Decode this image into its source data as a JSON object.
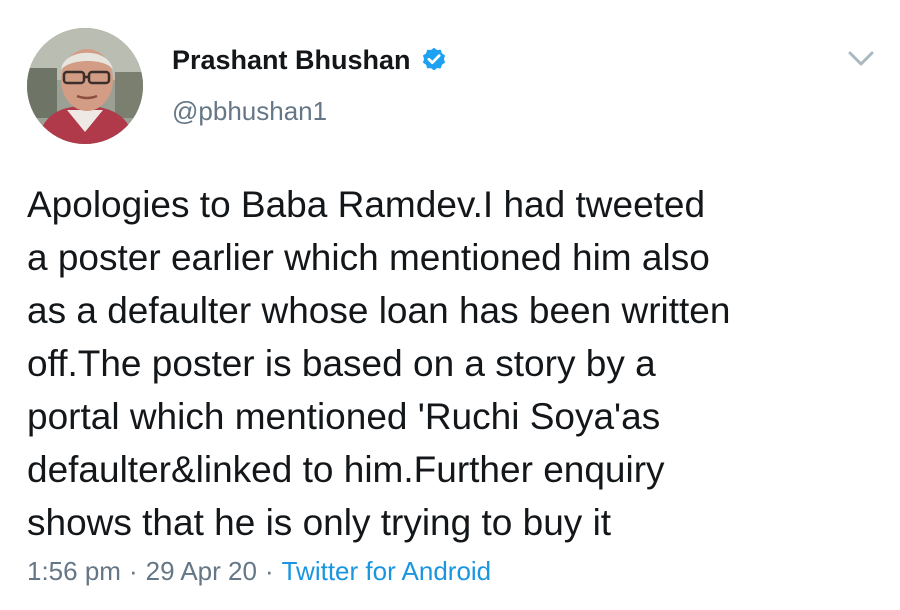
{
  "author": {
    "display_name": "Prashant Bhushan",
    "handle": "@pbhushan1",
    "verified_icon": "verified-badge-icon"
  },
  "menu": {
    "icon": "chevron-down-icon"
  },
  "tweet": {
    "text": "Apologies to Baba Ramdev.I had tweeted\na poster earlier which mentioned him also\nas a defaulter whose loan has been written\noff.The poster is based on a story by a\nportal which mentioned 'Ruchi Soya'as\ndefaulter&linked to him.Further enquiry\nshows that he is only trying to buy it"
  },
  "meta": {
    "time": "1:56 pm",
    "separator": "·",
    "date": "29 Apr 20",
    "source": "Twitter for Android"
  },
  "colors": {
    "text": "#14171a",
    "secondary": "#657786",
    "accent": "#1b95e0"
  }
}
